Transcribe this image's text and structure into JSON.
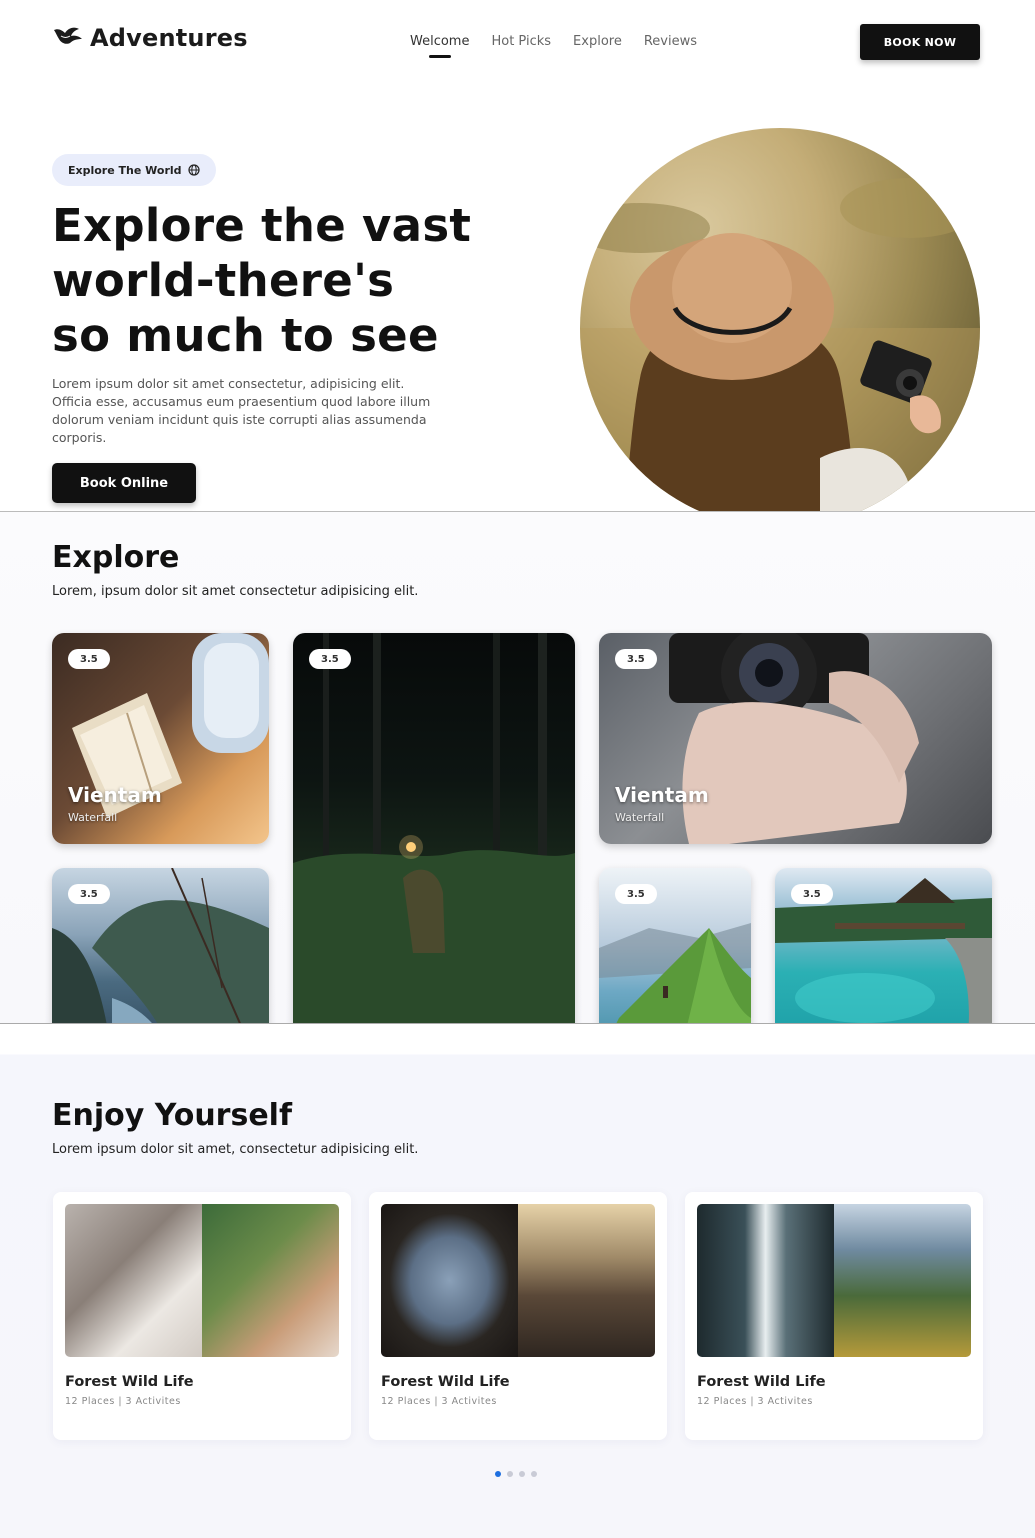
{
  "header": {
    "brand": "Adventures",
    "nav": [
      "Welcome",
      "Hot Picks",
      "Explore",
      "Reviews"
    ],
    "active_nav": "Welcome",
    "cta": "BOOK NOW"
  },
  "hero": {
    "badge": "Explore The World",
    "title_lines": [
      "Explore the vast",
      "world-there's",
      "so much to see"
    ],
    "description": "Lorem ipsum dolor sit amet consectetur, adipisicing elit. Officia esse, accusamus eum praesentium quod labore illum dolorum veniam incidunt quis iste corrupti alias assumenda corporis.",
    "button": "Book Online"
  },
  "explore": {
    "title": "Explore",
    "subtitle": "Lorem, ipsum dolor sit amet consectetur adipisicing elit.",
    "cards": [
      {
        "rating": "3.5",
        "title": "Vientam",
        "subtitle": "Waterfall"
      },
      {
        "rating": "3.5",
        "title": "",
        "subtitle": ""
      },
      {
        "rating": "3.5",
        "title": "Vientam",
        "subtitle": "Waterfall"
      },
      {
        "rating": "3.5",
        "title": "",
        "subtitle": ""
      },
      {
        "rating": "3.5",
        "title": "",
        "subtitle": ""
      },
      {
        "rating": "3.5",
        "title": "",
        "subtitle": ""
      }
    ]
  },
  "enjoy": {
    "title": "Enjoy Yourself",
    "subtitle": "Lorem ipsum dolor sit amet, consectetur adipisicing elit.",
    "tiles": [
      {
        "title": "Forest Wild Life",
        "meta": "12 Places | 3 Activites"
      },
      {
        "title": "Forest Wild Life",
        "meta": "12 Places | 3 Activites"
      },
      {
        "title": "Forest Wild Life",
        "meta": "12 Places | 3 Activites"
      }
    ],
    "carousel": {
      "pages": 4,
      "active": 1
    }
  },
  "colors": {
    "brand_dark": "#111111",
    "badge_bg": "#e9edfb",
    "dot_active": "#1e6fe0"
  }
}
